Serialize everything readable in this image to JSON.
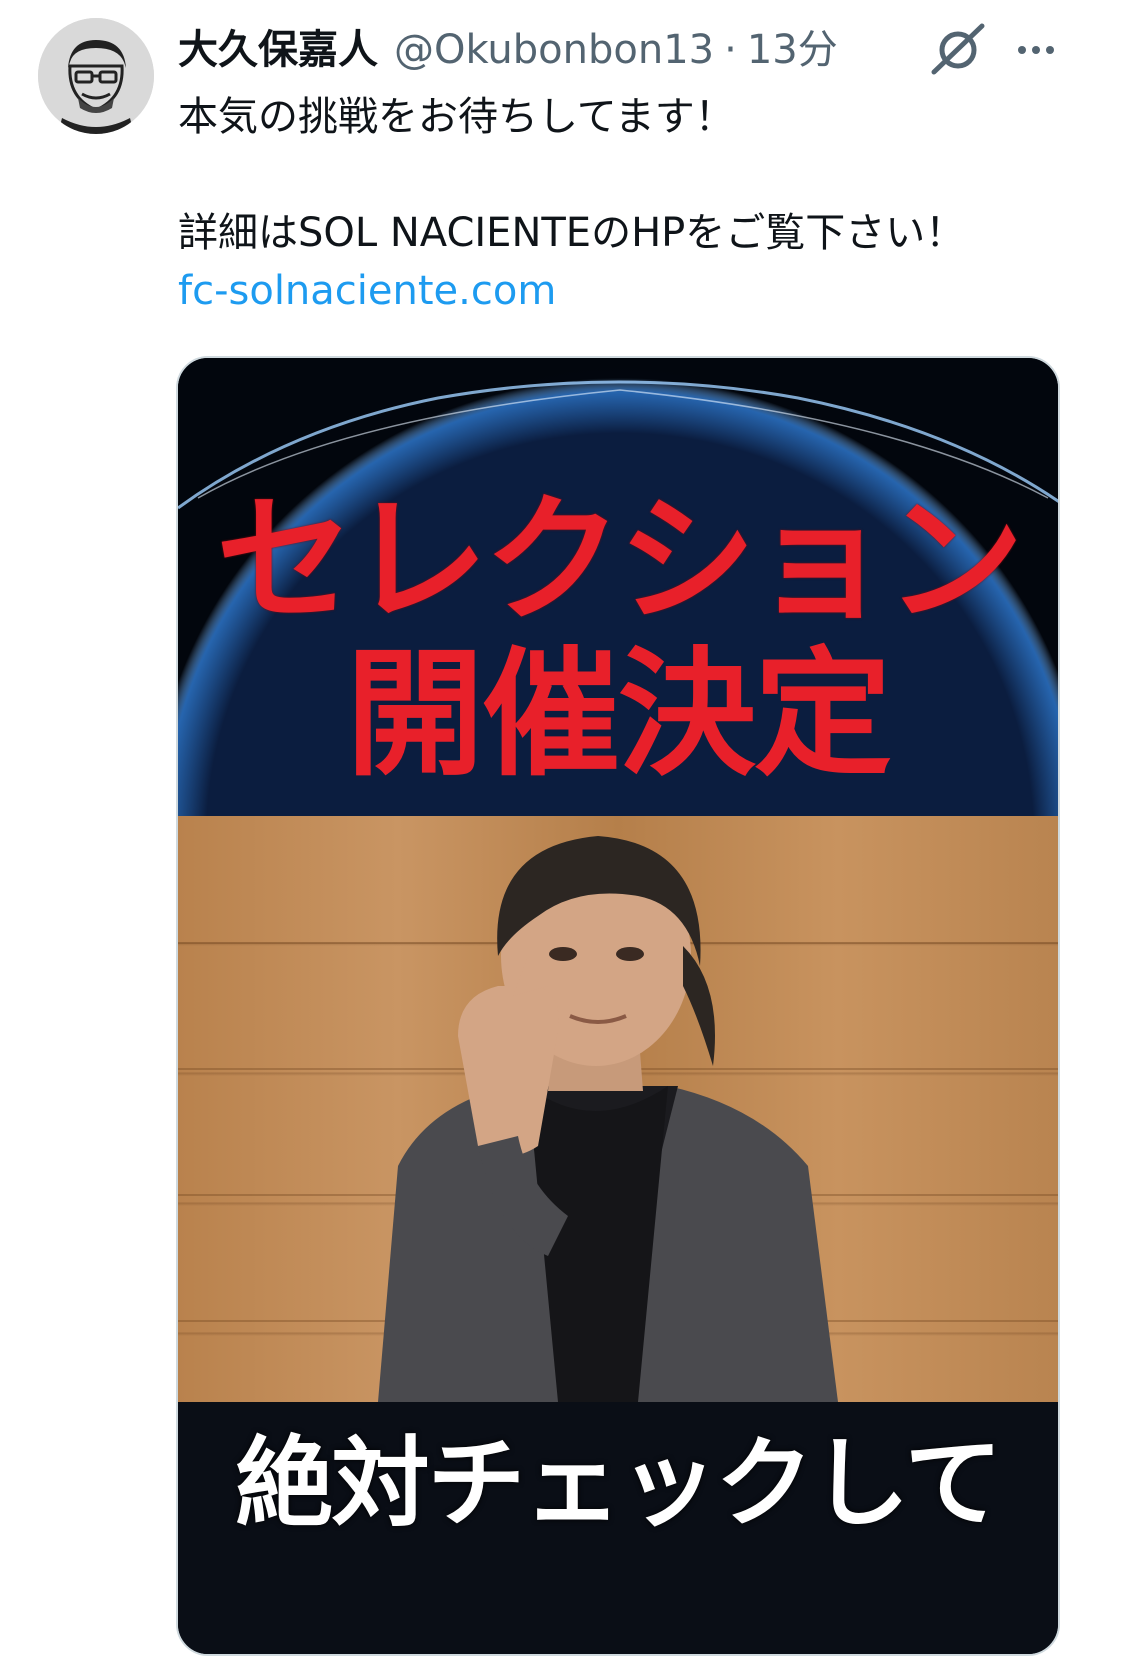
{
  "tweet": {
    "display_name": "大久保嘉人",
    "handle": "@Okubonbon13",
    "separator": "·",
    "timestamp": "13分",
    "lines": {
      "line1": "本気の挑戦をお待ちしてます！",
      "line2": "詳細はSOL NACIENTEのHPをご覧下さい！",
      "link": "fc-solnaciente.com"
    },
    "media": {
      "headline_line1": "セレクション",
      "headline_line2": "開催決定",
      "caption": "絶対チェックして"
    }
  },
  "icons": {
    "avatar": "avatar-illustration",
    "grok": "grok-icon",
    "more": "more-icon"
  },
  "colors": {
    "text": "#0f1419",
    "secondary": "#536471",
    "link": "#1d9bf0",
    "headline_red": "#e8202a",
    "media_border": "#cfd9de"
  }
}
